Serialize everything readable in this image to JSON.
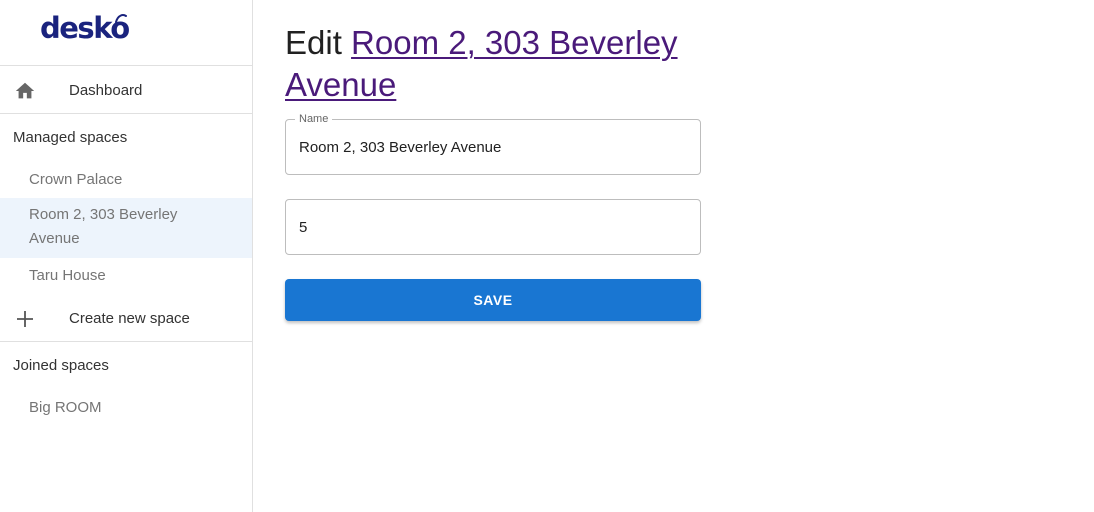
{
  "app": {
    "logo_text": "desko"
  },
  "sidebar": {
    "dashboard": {
      "label": "Dashboard",
      "icon": "home-icon"
    },
    "managed_spaces": {
      "title": "Managed spaces",
      "items": [
        {
          "label": "Crown Palace",
          "selected": false
        },
        {
          "label": "Room 2, 303 Beverley Avenue",
          "selected": true
        },
        {
          "label": "Taru House",
          "selected": false
        }
      ]
    },
    "create_new_space": {
      "label": "Create new space",
      "icon": "plus-icon"
    },
    "joined_spaces": {
      "title": "Joined spaces",
      "items": [
        {
          "label": "Big ROOM",
          "selected": false
        }
      ]
    }
  },
  "main": {
    "title_prefix": "Edit",
    "title_link": "Room 2, 303 Beverley Avenue",
    "name_field": {
      "label": "Name",
      "value": "Room 2, 303 Beverley Avenue"
    },
    "number_field": {
      "value": "5"
    },
    "save_label": "SAVE"
  },
  "colors": {
    "accent": "#1976d2",
    "logo": "#1a237e",
    "link": "#4a1a7a",
    "selected_bg": "#edf4fc"
  }
}
